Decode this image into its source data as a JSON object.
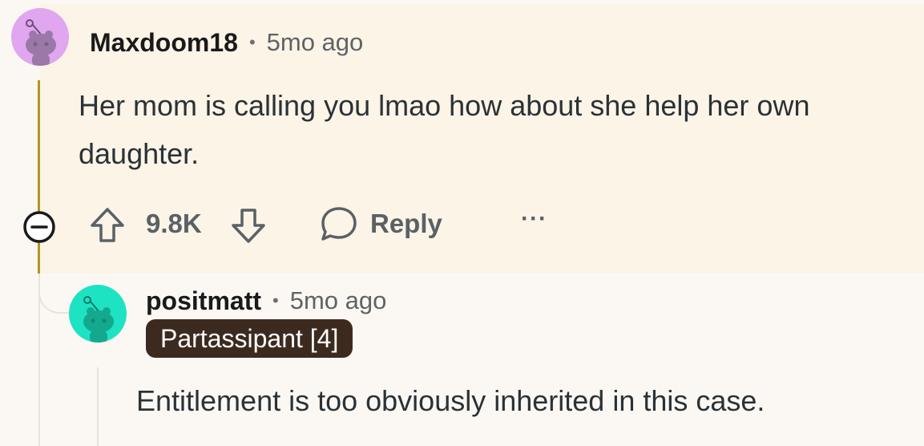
{
  "comment": {
    "username": "Maxdoom18",
    "separator": "•",
    "time": "5mo ago",
    "body": "Her mom is calling you lmao how about she help her own daughter.",
    "score": "9.8K",
    "reply_label": "Reply",
    "more_label": "···",
    "avatar_color": "#e0a6f0",
    "highlight_color": "#fbf4e7",
    "thread_color": "#b8941f"
  },
  "reply": {
    "username": "positmatt",
    "separator": "•",
    "time": "5mo ago",
    "flair": "Partassipant [4]",
    "body": "Entitlement is too obviously inherited in this case.",
    "avatar_color": "#1de3c3",
    "flair_color": "#3d2a1f"
  },
  "icons": [
    "collapse-icon",
    "upvote-icon",
    "downvote-icon",
    "reply-bubble-icon",
    "more-options-icon",
    "snoo-avatar-icon"
  ]
}
